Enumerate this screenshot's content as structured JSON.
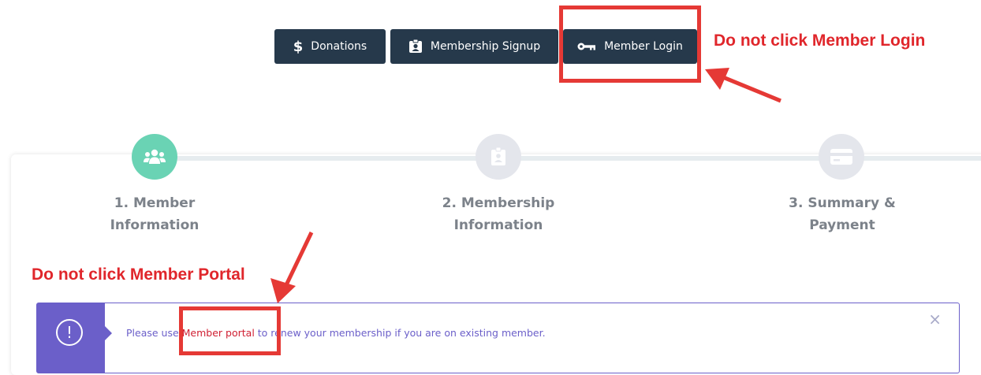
{
  "header": {
    "donations_label": "Donations",
    "signup_label": "Membership Signup",
    "login_label": "Member Login",
    "button_color": "#26394b"
  },
  "annotations": {
    "login_note": "Do not click Member Login",
    "portal_note": "Do not click Member Portal",
    "color": "#e53935"
  },
  "steps": [
    {
      "line1": "1. Member",
      "line2": "Information",
      "icon": "users-icon",
      "active": true,
      "color": "#6ad3b4"
    },
    {
      "line1": "2. Membership",
      "line2": "Information",
      "icon": "id-badge-icon",
      "active": false,
      "color": "#e4e6ec"
    },
    {
      "line1": "3. Summary &",
      "line2": "Payment",
      "icon": "credit-card-icon",
      "active": false,
      "color": "#e4e6ec"
    }
  ],
  "alert": {
    "prefix": "Please use ",
    "link": "Member portal",
    "suffix": " to renew your membership if you are on existing member.",
    "icon": "exclamation-circle-icon",
    "close_icon": "close-icon",
    "accent": "#6b5fc9"
  }
}
